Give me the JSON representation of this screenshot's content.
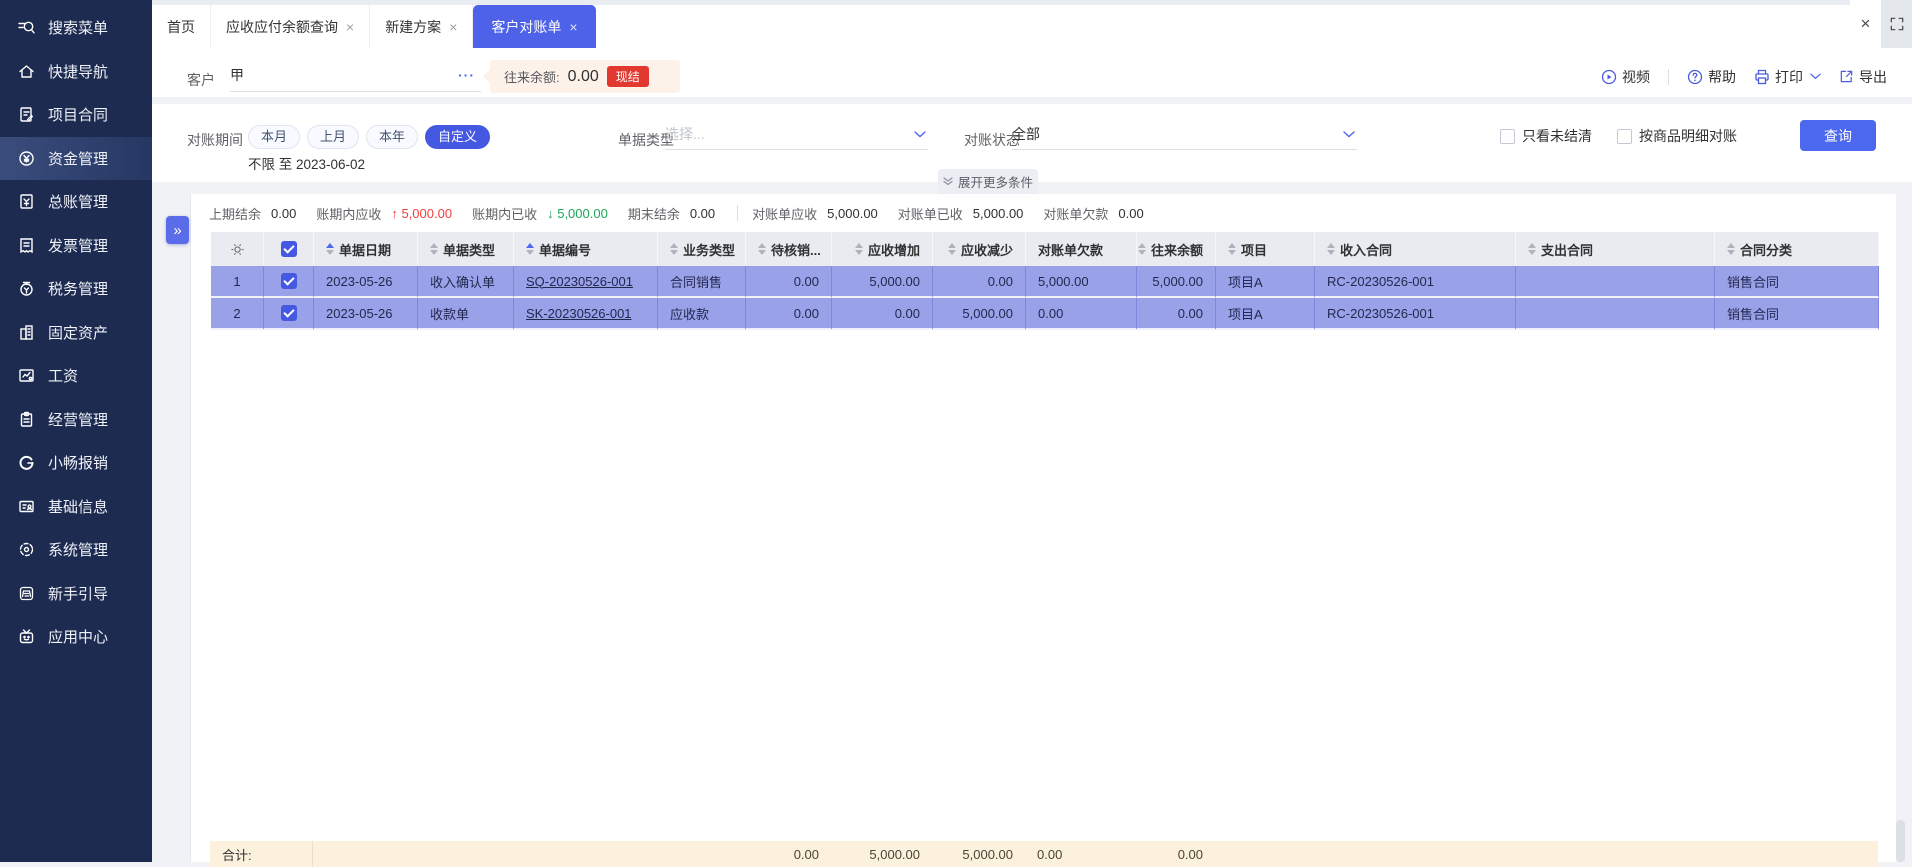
{
  "sidebar": {
    "items": [
      {
        "label": "搜索菜单",
        "icon": "search-icon"
      },
      {
        "label": "快捷导航",
        "icon": "home-icon"
      },
      {
        "label": "项目合同",
        "icon": "contract-icon"
      },
      {
        "label": "资金管理",
        "icon": "funds-icon",
        "active": true
      },
      {
        "label": "总账管理",
        "icon": "ledger-icon"
      },
      {
        "label": "发票管理",
        "icon": "invoice-icon"
      },
      {
        "label": "税务管理",
        "icon": "tax-icon"
      },
      {
        "label": "固定资产",
        "icon": "building-icon"
      },
      {
        "label": "工资",
        "icon": "salary-icon"
      },
      {
        "label": "经营管理",
        "icon": "clipboard-icon"
      },
      {
        "label": "小畅报销",
        "icon": "expense-icon"
      },
      {
        "label": "基础信息",
        "icon": "idcard-icon"
      },
      {
        "label": "系统管理",
        "icon": "system-icon"
      },
      {
        "label": "新手引导",
        "icon": "guide-icon"
      },
      {
        "label": "应用中心",
        "icon": "appcenter-icon"
      }
    ]
  },
  "tabs": {
    "close_glyph": "×",
    "items": [
      {
        "label": "首页",
        "closable": false,
        "active": false
      },
      {
        "label": "应收应付余额查询",
        "closable": true,
        "active": false
      },
      {
        "label": "新建方案",
        "closable": true,
        "active": false
      },
      {
        "label": "客户对账单",
        "closable": true,
        "active": true
      }
    ]
  },
  "window": {
    "close": "×"
  },
  "toolbar": {
    "customer_label": "客户",
    "customer_value": "甲",
    "ellipsis": "···",
    "balance_label": "往来余额:",
    "balance_value": "0.00",
    "badge": "现结",
    "actions": {
      "video": "视频",
      "help": "帮助",
      "print": "打印",
      "export": "导出"
    }
  },
  "filters": {
    "period_label": "对账期间",
    "period_options": [
      "本月",
      "上月",
      "本年"
    ],
    "period_custom": "自定义",
    "period_range": "不限 至 2023-06-02",
    "doc_type_label": "单据类型",
    "doc_type_placeholder": "选择...",
    "status_label": "对账状态",
    "status_value": "全部",
    "only_unsettled": "只看未结清",
    "by_product_detail": "按商品明细对账",
    "query_button": "查询",
    "expand_more": "展开更多条件"
  },
  "summary": {
    "prev_balance_label": "上期结余",
    "prev_balance": "0.00",
    "period_receivable_label": "账期内应收",
    "period_receivable": "5,000.00",
    "period_receivable_arrow": "↑",
    "period_received_label": "账期内已收",
    "period_received": "5,000.00",
    "period_received_arrow": "↓",
    "end_balance_label": "期末结余",
    "end_balance": "0.00",
    "stmt_receivable_label": "对账单应收",
    "stmt_receivable": "5,000.00",
    "stmt_received_label": "对账单已收",
    "stmt_received": "5,000.00",
    "stmt_arrears_label": "对账单欠款",
    "stmt_arrears": "0.00"
  },
  "table": {
    "columns": [
      "单据日期",
      "单据类型",
      "单据编号",
      "业务类型",
      "待核销...",
      "应收增加",
      "应收减少",
      "对账单欠款",
      "往来余额",
      "项目",
      "收入合同",
      "支出合同",
      "合同分类"
    ],
    "rows": [
      {
        "index": "1",
        "date": "2023-05-26",
        "doc_type": "收入确认单",
        "doc_no": "SQ-20230526-001",
        "biz_type": "合同销售",
        "pending": "0.00",
        "recv_increase": "5,000.00",
        "recv_decrease": "0.00",
        "stmt_arrears": "5,000.00",
        "balance": "5,000.00",
        "project": "项目A",
        "income_contract": "RC-20230526-001",
        "expense_contract": "",
        "contract_category": "销售合同"
      },
      {
        "index": "2",
        "date": "2023-05-26",
        "doc_type": "收款单",
        "doc_no": "SK-20230526-001",
        "biz_type": "应收款",
        "pending": "0.00",
        "recv_increase": "0.00",
        "recv_decrease": "5,000.00",
        "stmt_arrears": "0.00",
        "balance": "0.00",
        "project": "项目A",
        "income_contract": "RC-20230526-001",
        "expense_contract": "",
        "contract_category": "销售合同"
      }
    ],
    "total_label": "合计:",
    "totals": {
      "pending": "0.00",
      "recv_increase": "5,000.00",
      "recv_decrease": "5,000.00",
      "stmt_arrears": "0.00",
      "balance": "0.00"
    }
  }
}
